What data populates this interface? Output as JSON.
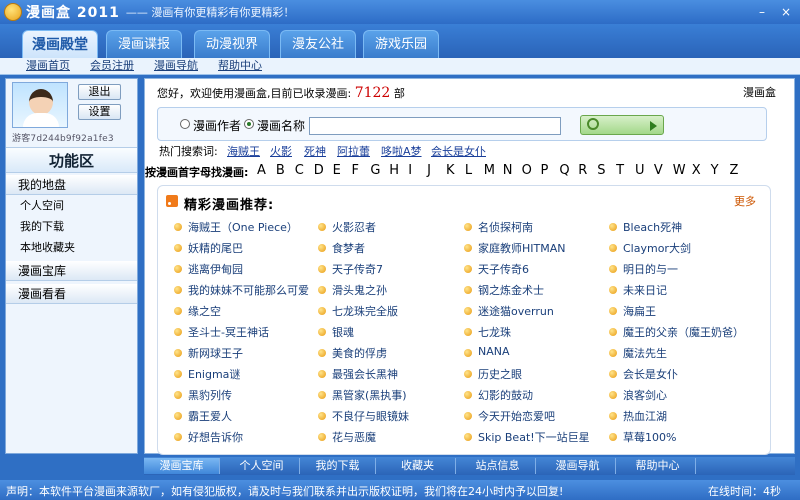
{
  "app": {
    "title": "漫画盒 2011",
    "slogan": "—— 漫画有你更精彩有你更精彩！"
  },
  "window": {
    "minimize": "–",
    "close": "×"
  },
  "tabs": [
    "漫画殿堂",
    "漫画谍报",
    "动漫视界",
    "漫友公社",
    "游戏乐园"
  ],
  "subnav": [
    "漫画首页",
    "会员注册",
    "漫画导航",
    "帮助中心"
  ],
  "user": {
    "logout": "退出",
    "settings": "设置",
    "guest_id": "游客7d244b9f92a1fe3"
  },
  "left": {
    "func_title": "功能区",
    "sections": [
      {
        "label": "我的地盘",
        "items": [
          "个人空间",
          "我的下载",
          "本地收藏夹"
        ]
      },
      {
        "label": "漫画宝库",
        "items": []
      },
      {
        "label": "漫画看看",
        "items": []
      }
    ]
  },
  "main": {
    "welcome": "您好，欢迎使用漫画盒,目前已收录漫画:",
    "count": "7122",
    "count_unit": "部",
    "welcome_right": "漫画盒",
    "search": {
      "option_author": "漫画作者",
      "option_name": "漫画名称",
      "button": "搜  索"
    },
    "hot_label": "热门搜索词:",
    "hot_words": [
      "海贼王",
      "火影",
      "死神",
      "阿拉蕾",
      "哆啦A梦",
      "会长是女仆"
    ],
    "alpha_label": "按漫画首字母找漫画:",
    "letters": [
      "A",
      "B",
      "C",
      "D",
      "E",
      "F",
      "G",
      "H",
      "I",
      "J",
      "K",
      "L",
      "M",
      "N",
      "O",
      "P",
      "Q",
      "R",
      "S",
      "T",
      "U",
      "V",
      "W",
      "X",
      "Y",
      "Z"
    ],
    "rec_title": "精彩漫画推荐:",
    "more": "更多",
    "recommendations": [
      [
        "海贼王（One Piece）",
        "火影忍者",
        "名侦探柯南",
        "Bleach死神"
      ],
      [
        "妖精的尾巴",
        "食梦者",
        "家庭教师HITMAN",
        "Claymor大剑"
      ],
      [
        "逃离伊甸园",
        "天子传奇7",
        "天子传奇6",
        "明日的与一"
      ],
      [
        "我的妹妹不可能那么可爱",
        "滑头鬼之孙",
        "钢之炼金术士",
        "未来日记"
      ],
      [
        "缘之空",
        "七龙珠完全版",
        "迷途猫overrun",
        "海扁王"
      ],
      [
        "圣斗士-冥王神话",
        "银魂",
        "七龙珠",
        "魔王的父亲（魔王奶爸）"
      ],
      [
        "新网球王子",
        "美食的俘虏",
        "NANA",
        "魔法先生"
      ],
      [
        "Enigma谜",
        "最强会长黑神",
        "历史之眼",
        "会长是女仆"
      ],
      [
        "黑豹列传",
        "黑管家(黑执事)",
        "幻影的鼓动",
        "浪客剑心"
      ],
      [
        "霸王爱人",
        "不良仔与眼镜妹",
        "今天开始恋爱吧",
        "热血江湖"
      ],
      [
        "好想告诉你",
        "花与恶魔",
        "Skip Beat!下一站巨星",
        "草莓100%"
      ]
    ]
  },
  "bottom_tabs": [
    "漫画宝库",
    "个人空间",
    "我的下载",
    "收藏夹",
    "站点信息",
    "漫画导航",
    "帮助中心"
  ],
  "status": {
    "text": "声明：本软件平台漫画来源软厂，如有侵犯版权，请及时与我们联系并出示版权证明，我们将在24小时内予以回复!",
    "online": "在线时间：4秒"
  }
}
